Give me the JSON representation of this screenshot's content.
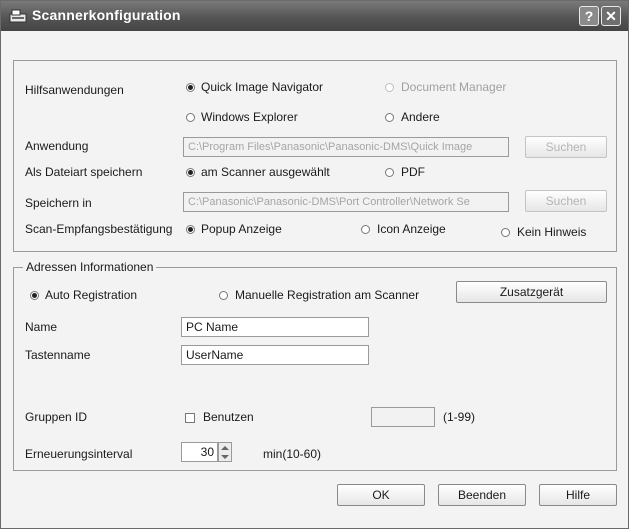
{
  "window": {
    "title": "Scannerkonfiguration",
    "help_button": "?",
    "close_button": "✕"
  },
  "general": {
    "hilfsanwendungen_label": "Hilfsanwendungen",
    "opt_quick_image": "Quick Image Navigator",
    "opt_document_manager": "Document Manager",
    "opt_windows_explorer": "Windows Explorer",
    "opt_andere": "Andere",
    "anwendung_label": "Anwendung",
    "anwendung_value": "C:\\Program Files\\Panasonic\\Panasonic-DMS\\Quick Image",
    "suchen1": "Suchen",
    "dateiart_label": "Als Dateiart speichern",
    "opt_am_scanner": "am Scanner ausgewählt",
    "opt_pdf": "PDF",
    "speichern_label": "Speichern in",
    "speichern_value": "C:\\Panasonic\\Panasonic-DMS\\Port Controller\\Network Se",
    "suchen2": "Suchen",
    "scan_label": "Scan-Empfangsbestätigung",
    "opt_popup": "Popup Anzeige",
    "opt_icon": "Icon Anzeige",
    "opt_kein": "Kein Hinweis"
  },
  "address": {
    "group_title": "Adressen Informationen",
    "opt_auto": "Auto Registration",
    "opt_manuell": "Manuelle Registration am Scanner",
    "zusatz": "Zusatzgerät",
    "name_label": "Name",
    "name_value": "PC Name",
    "tasten_label": "Tastenname",
    "tasten_value": "UserName",
    "gruppen_label": "Gruppen ID",
    "benutzen": "Benutzen",
    "range": "(1-99)",
    "interval_label": "Erneuerungsinterval",
    "interval_value": "30",
    "interval_unit": "min(10-60)"
  },
  "footer": {
    "ok": "OK",
    "beenden": "Beenden",
    "hilfe": "Hilfe"
  }
}
